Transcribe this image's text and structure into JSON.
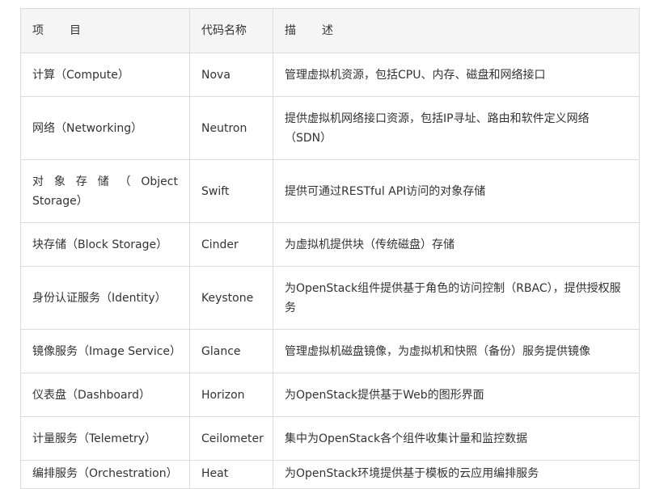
{
  "table": {
    "headers": {
      "col1_a": "项",
      "col1_b": "目",
      "col2": "代码名称",
      "col3_a": "描",
      "col3_b": "述"
    },
    "rows": [
      {
        "name": "计算（Compute）",
        "code": "Nova",
        "desc": "管理虚拟机资源，包括CPU、内存、磁盘和网络接口"
      },
      {
        "name": "网络（Networking）",
        "code": "Neutron",
        "desc": "提供虚拟机网络接口资源，包括IP寻址、路由和软件定义网络（SDN）"
      },
      {
        "name": "对象存储（Object Storage）",
        "code": "Swift",
        "desc": "提供可通过RESTful API访问的对象存储"
      },
      {
        "name": "块存储（Block Storage）",
        "code": "Cinder",
        "desc": "为虚拟机提供块（传统磁盘）存储"
      },
      {
        "name": "身份认证服务（Identity）",
        "code": "Keystone",
        "desc": "为OpenStack组件提供基于角色的访问控制（RBAC），提供授权服务"
      },
      {
        "name": "镜像服务（Image Service）",
        "code": "Glance",
        "desc": "管理虚拟机磁盘镜像，为虚拟机和快照（备份）服务提供镜像"
      },
      {
        "name": "仪表盘（Dashboard）",
        "code": "Horizon",
        "desc": "为OpenStack提供基于Web的图形界面"
      },
      {
        "name": "计量服务（Telemetry）",
        "code": "Ceilometer",
        "desc": "集中为OpenStack各个组件收集计量和监控数据"
      },
      {
        "name": "编排服务（Orchestration）",
        "code": "Heat",
        "desc": "为OpenStack环境提供基于模板的云应用编排服务"
      }
    ]
  }
}
